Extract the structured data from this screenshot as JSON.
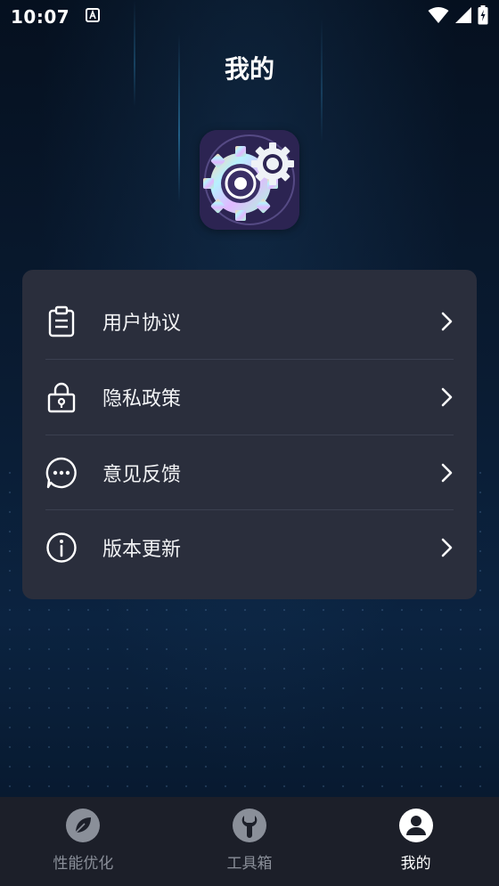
{
  "status_bar": {
    "time": "10:07"
  },
  "header": {
    "title": "我的"
  },
  "menu": {
    "items": [
      {
        "label": "用户协议",
        "icon": "clipboard-icon"
      },
      {
        "label": "隐私政策",
        "icon": "lock-icon"
      },
      {
        "label": "意见反馈",
        "icon": "chat-bubble-icon"
      },
      {
        "label": "版本更新",
        "icon": "info-icon"
      }
    ]
  },
  "tabs": [
    {
      "label": "性能优化",
      "icon": "leaf-icon",
      "active": false
    },
    {
      "label": "工具箱",
      "icon": "wrench-icon",
      "active": false
    },
    {
      "label": "我的",
      "icon": "person-icon",
      "active": true
    }
  ],
  "colors": {
    "background": "#061226",
    "card": "#2a2e3c",
    "tab_bar": "#1c1f29",
    "inactive_tab_text": "#8a8f99",
    "active_tab": "#ffffff"
  }
}
